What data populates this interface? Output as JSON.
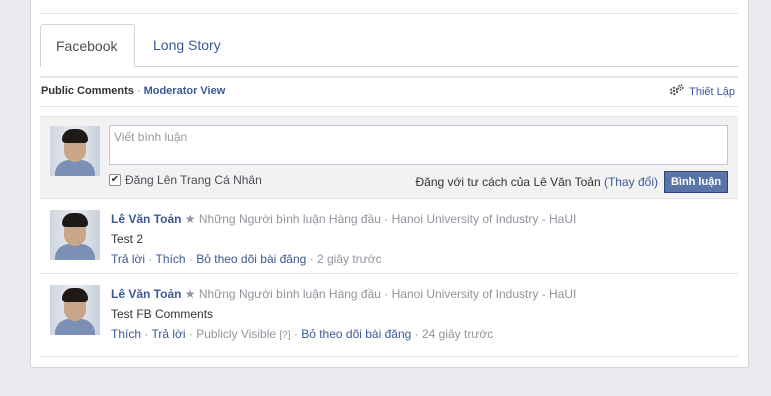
{
  "tabs": [
    {
      "label": "Facebook",
      "active": true
    },
    {
      "label": "Long Story",
      "active": false
    }
  ],
  "nav": {
    "public_comments": "Public Comments",
    "separator": "·",
    "moderator_view": "Moderator View",
    "settings_label": "Thiết Lập"
  },
  "composer": {
    "placeholder": "Viết bình luận",
    "post_to_profile_label": "Đăng Lên Trang Cá Nhân",
    "post_to_profile_checked": true,
    "posting_as": "Đăng với tư cách của Lê Văn Toản",
    "change_link": "(Thay đổi)",
    "submit_label": "Bình luận"
  },
  "comments": [
    {
      "author": "Lê Văn Toản",
      "badge": "★ Những Người bình luận Hàng đầu",
      "affiliation": "· Hanoi University of Industry - HaUI",
      "text": "Test 2",
      "actions": [
        "Trả lời",
        "Thích",
        "Bỏ theo dõi bài đăng"
      ],
      "time": "2 giây trước"
    },
    {
      "author": "Lê Văn Toản",
      "badge": "★ Những Người bình luận Hàng đầu",
      "affiliation": "· Hanoi University of Industry - HaUI",
      "text": "Test FB Comments",
      "actions": [
        "Thích",
        "Trả lời"
      ],
      "visibility": "Publicly Visible",
      "help": "[?]",
      "unfollow": "Bỏ theo dõi bài đăng",
      "time": "24 giây trước"
    }
  ],
  "colors": {
    "link": "#3b5998",
    "button": "#5b74a8",
    "background": "#e9eaed"
  }
}
